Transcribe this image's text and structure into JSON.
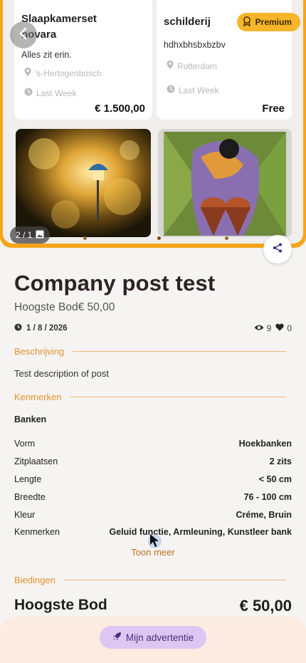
{
  "gallery": {
    "counter": "2 / 1",
    "premium_label": "Premium",
    "cards": [
      {
        "title": "Slaapkamerset novara",
        "desc": "Alles zit erin.",
        "location": "'s-Hertogenbosch",
        "time": "Last Week",
        "price": "€ 1.500,00"
      },
      {
        "title": "schilderij",
        "desc": "hdhxbhsbxbzbv",
        "location": "Rotterdam",
        "time": "Last Week",
        "price": "Free"
      }
    ]
  },
  "post": {
    "title": "Company post test",
    "highest_bid_line": "Hoogste Bod€ 50,00",
    "date": "1 / 8 / 2026",
    "views": "9",
    "likes": "0"
  },
  "sections": {
    "description": "Beschrijving",
    "features": "Kenmerken",
    "bids": "Biedingen"
  },
  "description_text": "Test description of post",
  "category": "Banken",
  "attributes": [
    {
      "label": "Vorm",
      "value": "Hoekbanken"
    },
    {
      "label": "Zitplaatsen",
      "value": "2 zits"
    },
    {
      "label": "Lengte",
      "value": "< 50 cm"
    },
    {
      "label": "Breedte",
      "value": "76 - 100 cm"
    },
    {
      "label": "Kleur",
      "value": "Créme, Bruin"
    },
    {
      "label": "Kenmerken",
      "value": "Geluid functie, Armleuning, Kunstleer bank"
    }
  ],
  "show_more": "Toon meer",
  "bids": {
    "label": "Hoogste Bod",
    "amount": "€ 50,00"
  },
  "bottom": {
    "my_ad_label": "Mijn advertentie"
  },
  "colors": {
    "accent": "#e8912e",
    "premium": "#f6b52a",
    "frame": "#f6a51a",
    "button": "#dcc6f2"
  }
}
